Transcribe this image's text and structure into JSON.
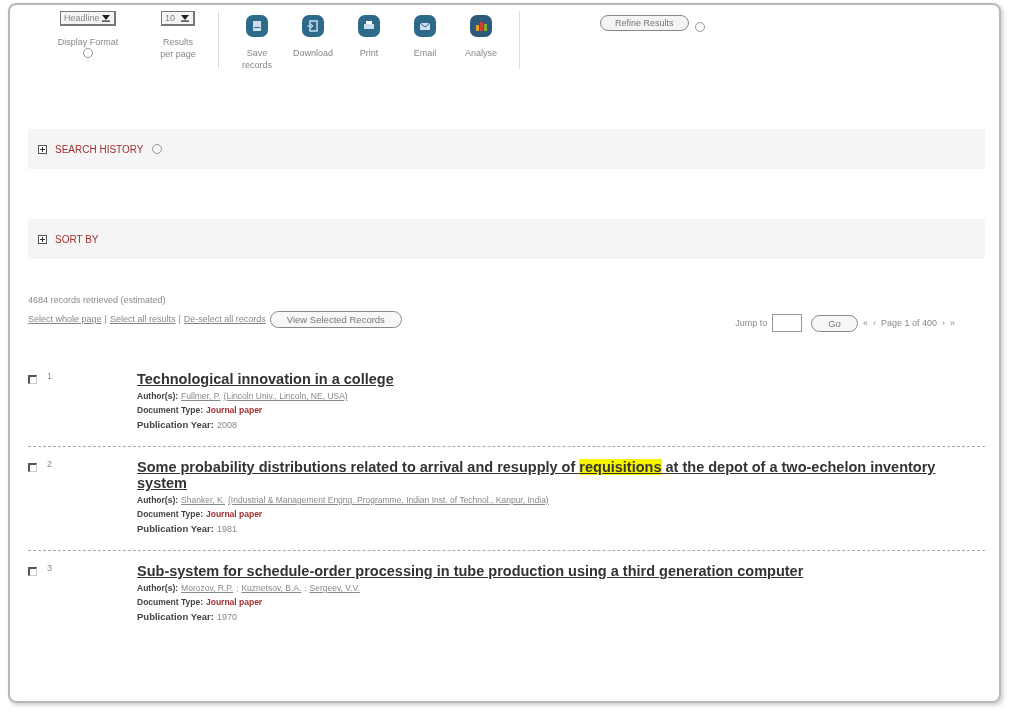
{
  "toolbar": {
    "selects": [
      {
        "value": "Headline",
        "label": "Display Format",
        "help": true
      },
      {
        "value": "10",
        "label": "Results per page",
        "help": false
      }
    ],
    "actions": [
      {
        "kind": "save",
        "label": "Save records"
      },
      {
        "kind": "download",
        "label": "Download"
      },
      {
        "kind": "print",
        "label": "Print"
      },
      {
        "kind": "email",
        "label": "Email"
      },
      {
        "kind": "analyse",
        "label": "Analyse"
      }
    ],
    "refine_button": "Refine Results"
  },
  "sections": [
    {
      "label": "SEARCH HISTORY",
      "expanded": false,
      "help": true
    },
    {
      "label": "SORT BY",
      "expanded": false,
      "help": false
    }
  ],
  "summary": "4684 records retrieved (estimated)",
  "link_separator": "|",
  "selection_links": [
    "Select whole page",
    "Select all results",
    "De-select all records"
  ],
  "view_selected_button": "View Selected Records",
  "pager": {
    "jump_label": "Jump to",
    "go_button": "Go",
    "first": "«",
    "prev": "‹",
    "text": "Page 1 of 400",
    "next": "›",
    "last": "»"
  },
  "records": [
    {
      "number": "1",
      "checked": false,
      "title": [
        {
          "text": "Technological innovation in a college",
          "highlighted": false
        }
      ],
      "authors_label": "Author(s):",
      "authors": [
        "Fullmer, P."
      ],
      "affiliation": "(Lincoln Univ., Lincoln, NE, USA)",
      "doc_type_label": "Document Type:",
      "doc_type": "Journal paper",
      "year_label": "Publication Year:",
      "year": "2008"
    },
    {
      "number": "2",
      "checked": false,
      "title": [
        {
          "text": "Some probability distributions related to arrival and resupply of ",
          "highlighted": false
        },
        {
          "text": "requisitions",
          "highlighted": true
        },
        {
          "text": " at the depot of a two-echelon inventory system",
          "highlighted": false
        }
      ],
      "authors_label": "Author(s):",
      "authors": [
        "Shanker, K."
      ],
      "affiliation": "(Industrial & Management Engng. Programme, Indian Inst. of Technol., Kanpur, India)",
      "doc_type_label": "Document Type:",
      "doc_type": "Journal paper",
      "year_label": "Publication Year:",
      "year": "1981"
    },
    {
      "number": "3",
      "checked": false,
      "title": [
        {
          "text": "Sub-system for schedule-order processing in tube production using a third generation computer",
          "highlighted": false
        }
      ],
      "authors_label": "Author(s):",
      "authors": [
        "Morozov, R.P.",
        "Kuznetsov, B.A.",
        "Sergeev, V.V."
      ],
      "author_separator": ";",
      "doc_type_label": "Document Type:",
      "doc_type": "Journal paper",
      "year_label": "Publication Year:",
      "year": "1970"
    }
  ]
}
